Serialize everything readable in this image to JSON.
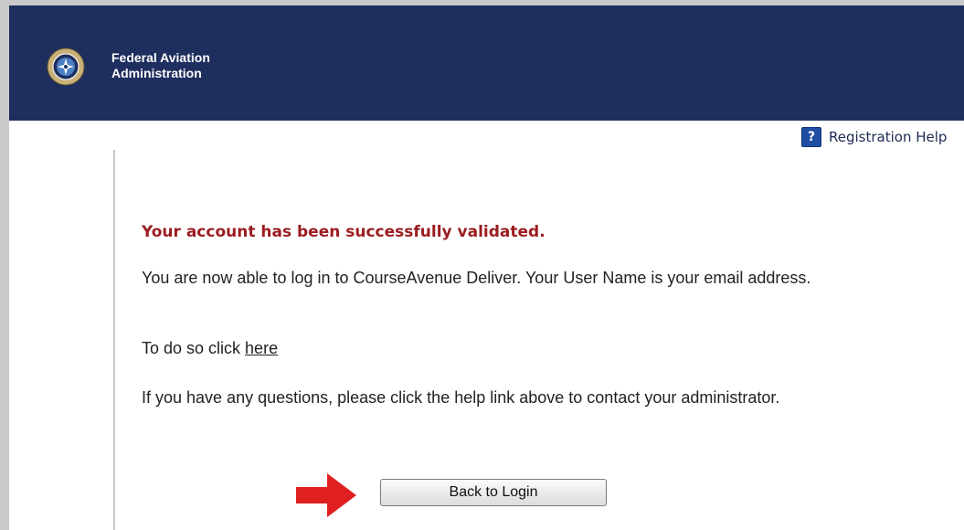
{
  "header": {
    "agency_line1": "Federal Aviation",
    "agency_line2": "Administration",
    "background_color": "#1e2e5e",
    "logo_icon": "faa-seal-icon"
  },
  "toolbar": {
    "help_icon": "question-mark-icon",
    "help_icon_glyph": "?",
    "help_label": "Registration Help"
  },
  "message": {
    "heading": "Your account has been successfully validated.",
    "heading_color": "#9b1c1f",
    "body_1": "You are now able to log in to CourseAvenue Deliver. Your User Name is your email address.",
    "body_2_prefix": "To do so click ",
    "body_2_link": "here",
    "body_3": "If you have any questions, please click the help link above to contact your administrator."
  },
  "actions": {
    "back_label": "Back to Login",
    "pointer_arrow_icon": "red-arrow-right-icon",
    "pointer_arrow_color": "#e02020"
  }
}
